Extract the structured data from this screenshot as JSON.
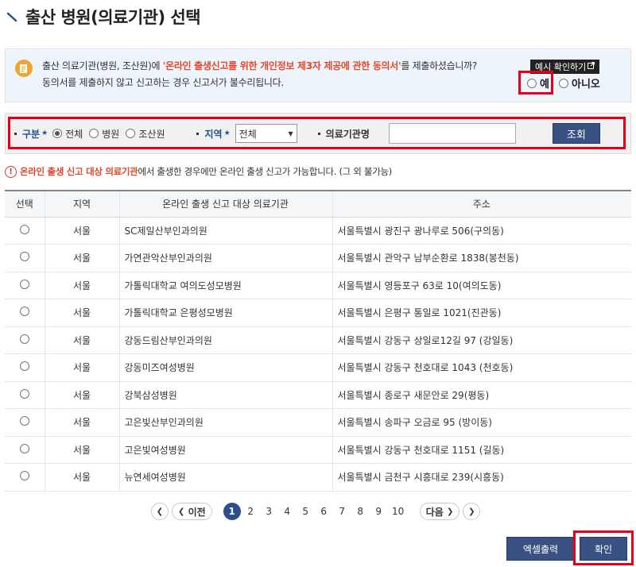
{
  "page": {
    "title": "출산 병원(의료기관) 선택"
  },
  "consent": {
    "line1_pre": "출산 의료기관(병원, 조산원)에 ",
    "line1_highlight": "'온라인 출생신고를 위한 개인정보 제3자 제공에 관한 동의서'",
    "line1_post": "를 제출하셨습니까?",
    "line2": "동의서를 제출하지 않고 신고하는 경우 신고서가 불수리됩니다.",
    "example_button": "예시 확인하기",
    "yes_label": "예",
    "no_label": "아니오"
  },
  "search": {
    "category_label": "구분",
    "category_options": [
      "전체",
      "병원",
      "조산원"
    ],
    "region_label": "지역",
    "region_selected": "전체",
    "institution_label": "의료기관명",
    "institution_value": "",
    "search_button": "조회"
  },
  "notice": {
    "highlight": "온라인 출생 신고 대상 의료기관",
    "rest": "에서 출생한 경우에만 온라인 출생 신고가 가능합니다. (그 외 불가능)"
  },
  "table": {
    "headers": [
      "선택",
      "지역",
      "온라인 출생 신고 대상 의료기관",
      "주소"
    ],
    "rows": [
      {
        "region": "서울",
        "name": "SC제일산부인과의원",
        "address": "서울특별시 광진구 광나루로 506(구의동)"
      },
      {
        "region": "서울",
        "name": "가연관악산부인과의원",
        "address": "서울특별시 관악구 남부순환로 1838(봉천동)"
      },
      {
        "region": "서울",
        "name": "가톨릭대학교 여의도성모병원",
        "address": "서울특별시 영등포구 63로 10(여의도동)"
      },
      {
        "region": "서울",
        "name": "가톨릭대학교 은평성모병원",
        "address": "서울특별시 은평구 통일로 1021(진관동)"
      },
      {
        "region": "서울",
        "name": "강동드림산부인과의원",
        "address": "서울특별시 강동구 상일로12길 97 (강일동)"
      },
      {
        "region": "서울",
        "name": "강동미즈여성병원",
        "address": "서울특별시 강동구 천호대로 1043 (천호동)"
      },
      {
        "region": "서울",
        "name": "강북삼성병원",
        "address": "서울특별시 종로구 새문안로 29(평동)"
      },
      {
        "region": "서울",
        "name": "고은빛산부인과의원",
        "address": "서울특별시 송파구 오금로 95 (방이동)"
      },
      {
        "region": "서울",
        "name": "고은빛여성병원",
        "address": "서울특별시 강동구 천호대로 1151 (길동)"
      },
      {
        "region": "서울",
        "name": "뉴연세여성병원",
        "address": "서울특별시 금천구 시흥대로 239(시흥동)"
      }
    ]
  },
  "pagination": {
    "prev_label": "이전",
    "next_label": "다음",
    "pages": [
      "1",
      "2",
      "3",
      "4",
      "5",
      "6",
      "7",
      "8",
      "9",
      "10"
    ],
    "current": "1"
  },
  "buttons": {
    "excel": "엑셀출력",
    "confirm": "확인"
  }
}
